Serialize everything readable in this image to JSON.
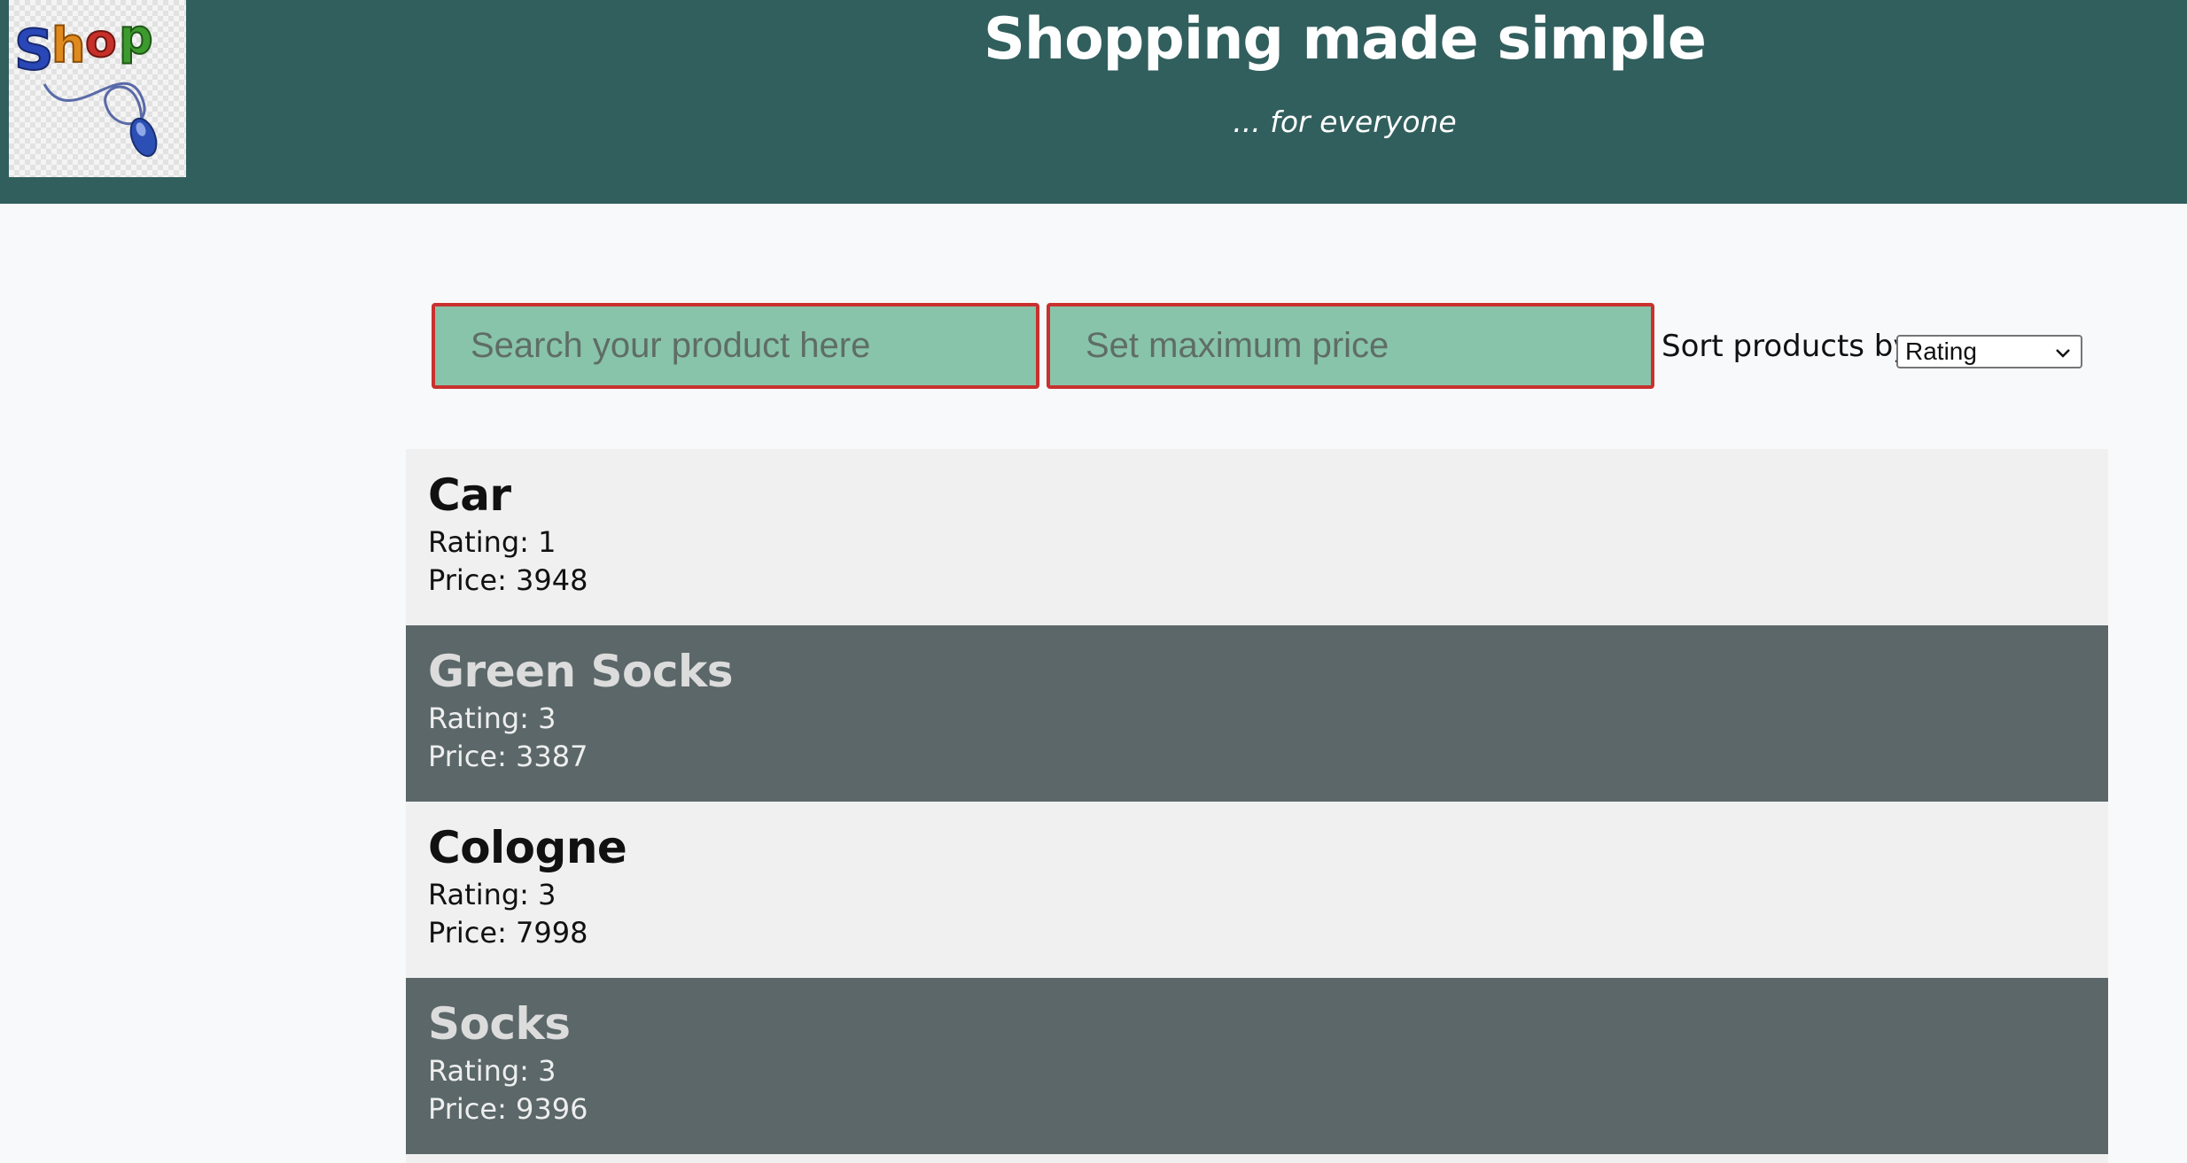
{
  "header": {
    "logo_text": "Shop",
    "title": "Shopping made simple",
    "subtitle": "... for everyone"
  },
  "filters": {
    "search_placeholder": "Search your product here",
    "max_price_placeholder": "Set maximum price",
    "sort_label": "Sort products by:",
    "sort_selected": "Rating"
  },
  "products": [
    {
      "name": "Car",
      "rating": "Rating: 1",
      "price": "Price: 3948"
    },
    {
      "name": "Green Socks",
      "rating": "Rating: 3",
      "price": "Price: 3387"
    },
    {
      "name": "Cologne",
      "rating": "Rating: 3",
      "price": "Price: 7998"
    },
    {
      "name": "Socks",
      "rating": "Rating: 3",
      "price": "Price: 9396"
    }
  ]
}
